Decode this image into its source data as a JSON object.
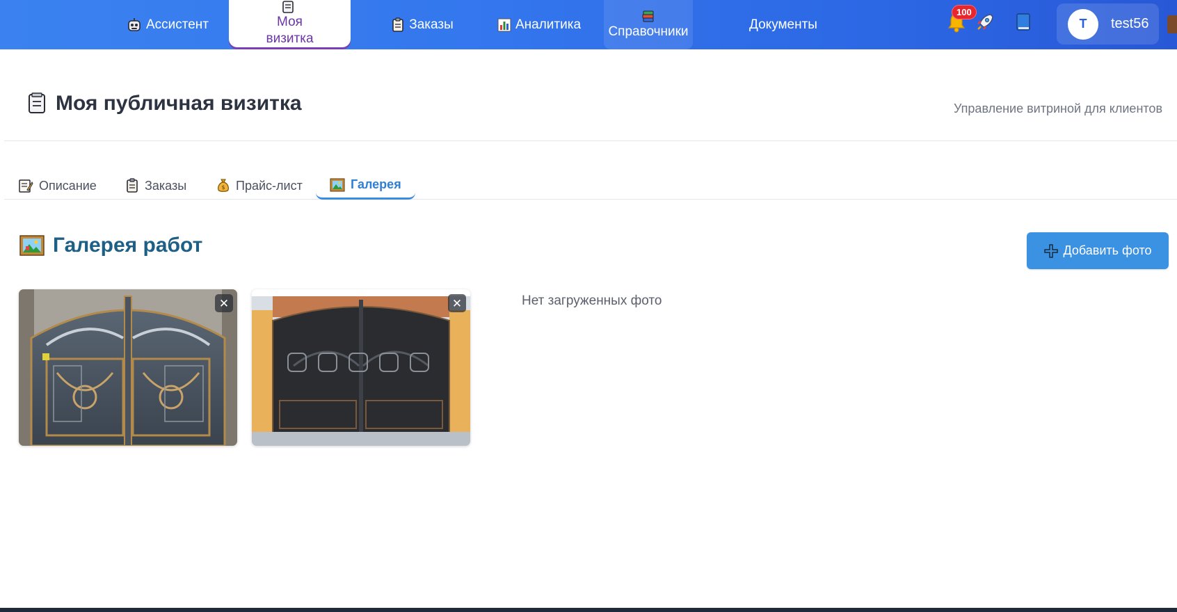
{
  "nav": {
    "items": [
      {
        "label": "Ассистент",
        "icon": "robot-icon"
      },
      {
        "label": "Моя визитка",
        "icon": "card-icon",
        "active": true
      },
      {
        "label": "Заказы",
        "icon": "clipboard-icon"
      },
      {
        "label": "Аналитика",
        "icon": "bar-chart-icon"
      },
      {
        "label": "Справочники",
        "icon": "books-icon"
      },
      {
        "label": "Документы",
        "icon": ""
      }
    ],
    "notifications_count": "100",
    "user": {
      "initial": "T",
      "name": "test56"
    }
  },
  "header": {
    "title": "Моя публичная визитка",
    "subtitle": "Управление витриной для клиентов"
  },
  "tabs": [
    {
      "label": "Описание",
      "icon": "memo-icon"
    },
    {
      "label": "Заказы",
      "icon": "clipboard-icon"
    },
    {
      "label": "Прайс-лист",
      "icon": "money-bag-icon"
    },
    {
      "label": "Галерея",
      "icon": "framed-picture-icon",
      "active": true
    }
  ],
  "gallery": {
    "title": "Галерея работ",
    "add_button_label": "Добавить фото",
    "empty_text": "Нет загруженных фото",
    "close_symbol": "✕"
  },
  "colors": {
    "nav_gradient_start": "#3b82f0",
    "nav_gradient_end": "#2858d6",
    "active_nav_text": "#6b35a8",
    "active_tab": "#2f7fd8",
    "section_title": "#1e5f86",
    "add_button": "#3b91e2",
    "badge": "#e8262e"
  }
}
